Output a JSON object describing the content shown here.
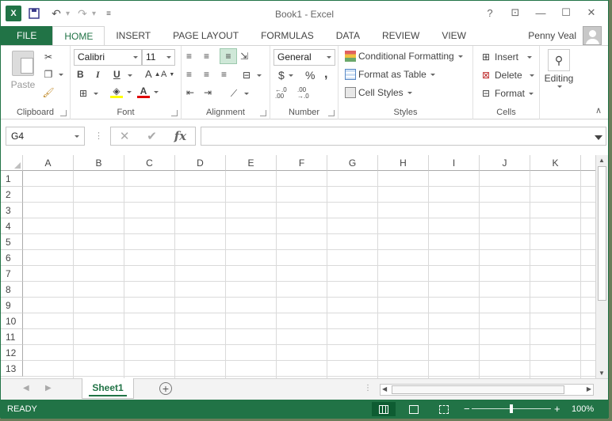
{
  "title": "Book1 - Excel",
  "qat": {
    "save": "save-icon",
    "undo": "undo-icon",
    "redo": "redo-icon"
  },
  "window_controls": {
    "help": "?",
    "restore_ribbon": "⊡",
    "minimize": "—",
    "maximize": "☐",
    "close": "✕"
  },
  "tabs": [
    "FILE",
    "HOME",
    "INSERT",
    "PAGE LAYOUT",
    "FORMULAS",
    "DATA",
    "REVIEW",
    "VIEW"
  ],
  "active_tab": "HOME",
  "user": "Penny Veal",
  "ribbon": {
    "clipboard": {
      "label": "Clipboard",
      "paste": "Paste"
    },
    "font": {
      "label": "Font",
      "name": "Calibri",
      "size": "11",
      "bold": "B",
      "italic": "I",
      "underline": "U"
    },
    "alignment": {
      "label": "Alignment"
    },
    "number": {
      "label": "Number",
      "format": "General",
      "currency": "$",
      "percent": "%",
      "comma": ",",
      "inc_decimal": "←.0 .00",
      "dec_decimal": ".00 →.0"
    },
    "styles": {
      "label": "Styles",
      "conditional": "Conditional Formatting",
      "format_table": "Format as Table",
      "cell_styles": "Cell Styles"
    },
    "cells": {
      "label": "Cells",
      "insert": "Insert",
      "delete": "Delete",
      "format": "Format"
    },
    "editing": {
      "label": "Editing"
    }
  },
  "name_box": "G4",
  "formula": "",
  "columns": [
    "A",
    "B",
    "C",
    "D",
    "E",
    "F",
    "G",
    "H",
    "I",
    "J",
    "K"
  ],
  "rows": [
    "1",
    "2",
    "3",
    "4",
    "5",
    "6",
    "7",
    "8",
    "9",
    "10",
    "11",
    "12",
    "13"
  ],
  "sheet_tab": "Sheet1",
  "status": {
    "ready": "READY",
    "zoom": "100%"
  },
  "colors": {
    "accent": "#217346"
  }
}
